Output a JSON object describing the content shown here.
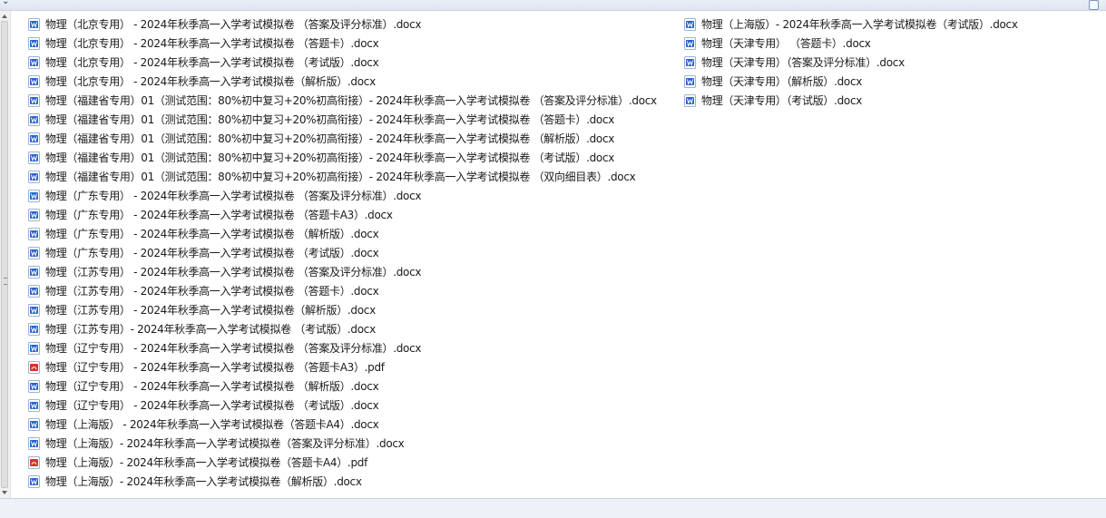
{
  "files_left": [
    {
      "name": "物理（北京专用） - 2024年秋季高一入学考试模拟卷 （答案及评分标准）.docx",
      "type": "word-icon"
    },
    {
      "name": "物理（北京专用） - 2024年秋季高一入学考试模拟卷 （答题卡）.docx",
      "type": "word-icon"
    },
    {
      "name": "物理（北京专用） - 2024年秋季高一入学考试模拟卷 （考试版）.docx",
      "type": "word-icon"
    },
    {
      "name": "物理（北京专用） - 2024年秋季高一入学考试模拟卷（解析版）.docx",
      "type": "word-icon"
    },
    {
      "name": "物理（福建省专用）01（测试范围：80%初中复习+20%初高衔接）- 2024年秋季高一入学考试模拟卷 （答案及评分标准）.docx",
      "type": "word-icon"
    },
    {
      "name": "物理（福建省专用）01（测试范围：80%初中复习+20%初高衔接）- 2024年秋季高一入学考试模拟卷 （答题卡）.docx",
      "type": "word-icon"
    },
    {
      "name": "物理（福建省专用）01（测试范围：80%初中复习+20%初高衔接）- 2024年秋季高一入学考试模拟卷 （解析版）.docx",
      "type": "word-icon"
    },
    {
      "name": "物理（福建省专用）01（测试范围：80%初中复习+20%初高衔接）- 2024年秋季高一入学考试模拟卷 （考试版）.docx",
      "type": "word-icon"
    },
    {
      "name": "物理（福建省专用）01（测试范围：80%初中复习+20%初高衔接）- 2024年秋季高一入学考试模拟卷 （双向细目表）.docx",
      "type": "word-icon"
    },
    {
      "name": "物理（广东专用） - 2024年秋季高一入学考试模拟卷 （答案及评分标准）.docx",
      "type": "word-icon"
    },
    {
      "name": "物理（广东专用） - 2024年秋季高一入学考试模拟卷 （答题卡A3）.docx",
      "type": "word-icon"
    },
    {
      "name": "物理（广东专用） - 2024年秋季高一入学考试模拟卷 （解析版）.docx",
      "type": "word-icon"
    },
    {
      "name": "物理（广东专用） - 2024年秋季高一入学考试模拟卷 （考试版）.docx",
      "type": "word-icon"
    },
    {
      "name": "物理（江苏专用） - 2024年秋季高一入学考试模拟卷 （答案及评分标准）.docx",
      "type": "word-icon"
    },
    {
      "name": "物理（江苏专用） - 2024年秋季高一入学考试模拟卷 （答题卡）.docx",
      "type": "word-icon"
    },
    {
      "name": "物理（江苏专用） - 2024年秋季高一入学考试模拟卷（解析版）.docx",
      "type": "word-icon"
    },
    {
      "name": "物理（江苏专用）- 2024年秋季高一入学考试模拟卷 （考试版）.docx",
      "type": "word-icon"
    },
    {
      "name": "物理（辽宁专用） - 2024年秋季高一入学考试模拟卷 （答案及评分标准）.docx",
      "type": "word-icon"
    },
    {
      "name": "物理（辽宁专用） - 2024年秋季高一入学考试模拟卷 （答题卡A3）.pdf",
      "type": "pdf-icon"
    },
    {
      "name": "物理（辽宁专用） - 2024年秋季高一入学考试模拟卷 （解析版）.docx",
      "type": "word-icon"
    },
    {
      "name": "物理（辽宁专用） - 2024年秋季高一入学考试模拟卷 （考试版）.docx",
      "type": "word-icon"
    },
    {
      "name": "物理（上海版） - 2024年秋季高一入学考试模拟卷（答题卡A4）.docx",
      "type": "word-icon"
    },
    {
      "name": "物理（上海版）- 2024年秋季高一入学考试模拟卷（答案及评分标准）.docx",
      "type": "word-icon"
    },
    {
      "name": "物理（上海版）- 2024年秋季高一入学考试模拟卷（答题卡A4）.pdf",
      "type": "pdf-icon"
    },
    {
      "name": "物理（上海版）- 2024年秋季高一入学考试模拟卷（解析版）.docx",
      "type": "word-icon"
    }
  ],
  "files_right": [
    {
      "name": "物理（上海版）- 2024年秋季高一入学考试模拟卷（考试版）.docx",
      "type": "word-icon"
    },
    {
      "name": "物理（天津专用） （答题卡）.docx",
      "type": "word-icon"
    },
    {
      "name": "物理（天津专用）（答案及评分标准）.docx",
      "type": "word-icon"
    },
    {
      "name": "物理（天津专用）（解析版）.docx",
      "type": "word-icon"
    },
    {
      "name": "物理（天津专用）（考试版）.docx",
      "type": "word-icon"
    }
  ],
  "colors": {
    "word_icon_blue": "#2b63c6",
    "pdf_icon_red": "#d8322c"
  }
}
